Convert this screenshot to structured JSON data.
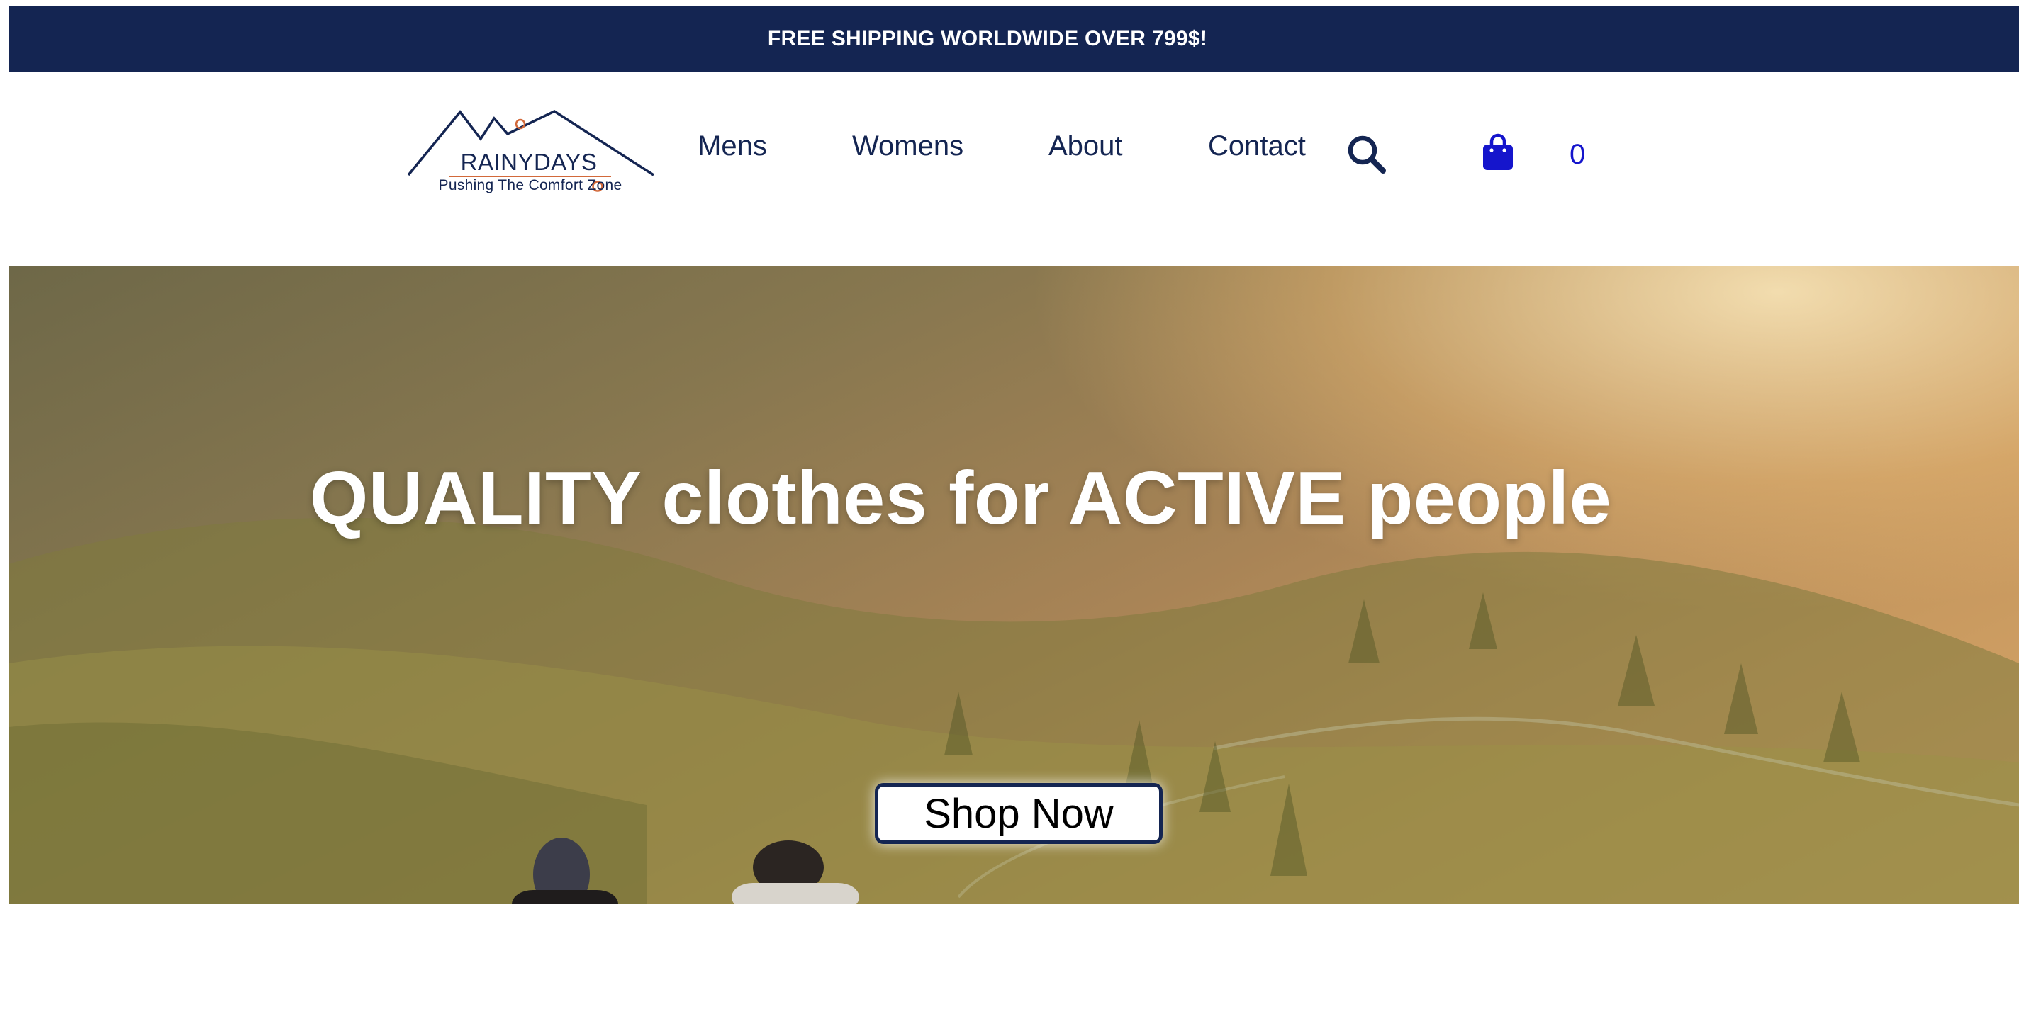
{
  "promo": {
    "text": "FREE SHIPPING WORLDWIDE OVER 799$!"
  },
  "logo": {
    "name": "RAINYDAYS",
    "tagline": "Pushing The Comfort Zone"
  },
  "nav": {
    "items": [
      {
        "label": "Mens"
      },
      {
        "label": "Womens"
      },
      {
        "label": "About"
      },
      {
        "label": "Contact"
      }
    ]
  },
  "icons": {
    "search": "search-icon",
    "cart": "shopping-bag-icon"
  },
  "cart": {
    "count": "0"
  },
  "hero": {
    "title": "QUALITY clothes for ACTIVE people",
    "button_label": "Shop Now"
  },
  "colors": {
    "navy": "#142552",
    "cart_blue": "#1515cc",
    "logo_accent": "#d2693a",
    "white": "#ffffff"
  }
}
